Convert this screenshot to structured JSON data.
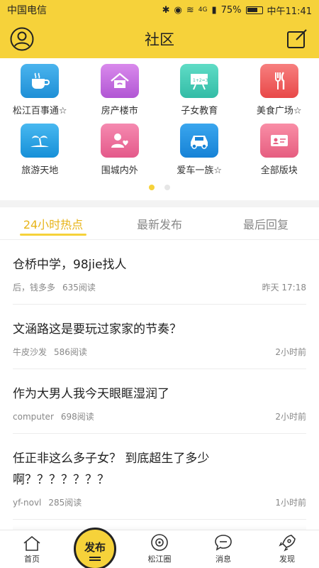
{
  "status": {
    "carrier": "中国电信",
    "battery": "75%",
    "time": "中午11:41",
    "network": "4G"
  },
  "header": {
    "title": "社区",
    "left_icon": "user-icon",
    "right_icon": "edit-icon"
  },
  "categories": [
    {
      "label": "松江百事通☆",
      "icon": "coffee-icon",
      "color": "#2a9de0"
    },
    {
      "label": "房产楼市",
      "icon": "house-icon",
      "color": "#c86be0"
    },
    {
      "label": "子女教育",
      "icon": "blackboard-icon",
      "color": "#45cbb6"
    },
    {
      "label": "美食广场☆",
      "icon": "cutlery-icon",
      "color": "#f05a5a"
    },
    {
      "label": "旅游天地",
      "icon": "island-icon",
      "color": "#1ea0e0"
    },
    {
      "label": "围城内外",
      "icon": "person-heart-icon",
      "color": "#ee6a9a"
    },
    {
      "label": "爱车一族☆",
      "icon": "car-icon",
      "color": "#1a8ce0"
    },
    {
      "label": "全部版块",
      "icon": "card-icon",
      "color": "#f06a8a"
    }
  ],
  "colors": {
    "accent": "#f6d23a",
    "active_tab": "#e7b419"
  },
  "tabs": [
    "24小时热点",
    "最新发布",
    "最后回复"
  ],
  "posts": [
    {
      "title": "仓桥中学，98jie找人",
      "author": "后，钱多多",
      "reads": "635阅读",
      "time": "昨天 17:18"
    },
    {
      "title": "文涵路这是要玩过家家的节奏？",
      "author": "牛皮沙发",
      "reads": "586阅读",
      "time": "2小时前"
    },
    {
      "title": "作为大男人我今天眼眶湿润了",
      "author": "computer",
      "reads": "698阅读",
      "time": "2小时前"
    },
    {
      "title": "任正非这么多子女？ 到底超生了多少啊？？？？？？？",
      "author": "yf-novl",
      "reads": "285阅读",
      "time": "1小时前"
    }
  ],
  "tabbar": {
    "home": "首页",
    "publish": "发布",
    "circle": "松江圈",
    "messages": "消息",
    "discover": "发现"
  }
}
